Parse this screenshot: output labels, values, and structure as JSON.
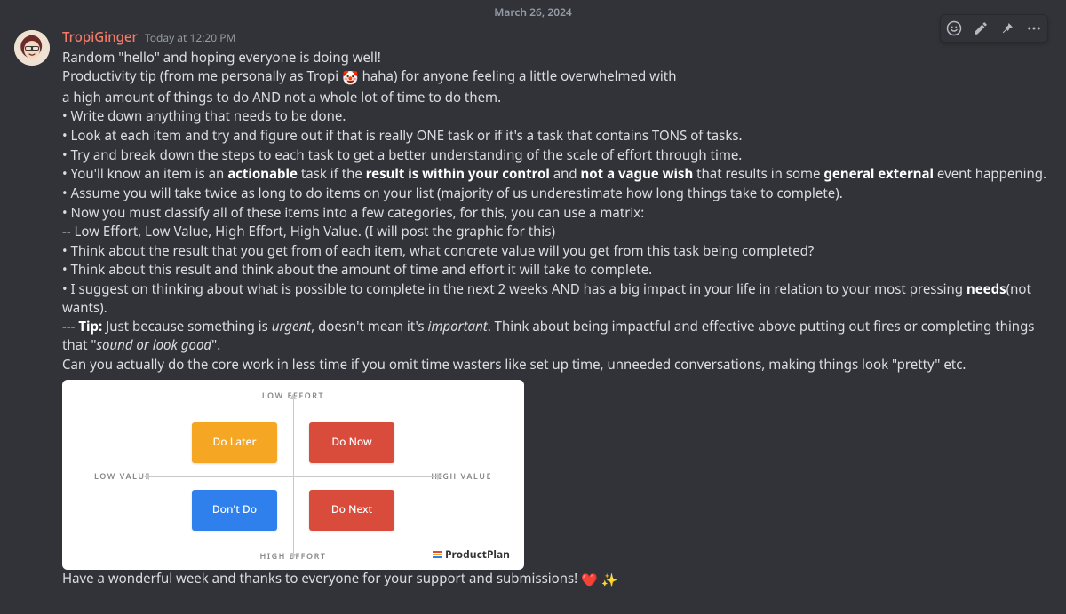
{
  "divider_date": "March 26, 2024",
  "message": {
    "username": "TropiGinger",
    "timestamp": "Today at 12:20 PM",
    "lines": {
      "l1": "Random \"hello\" and hoping everyone is doing well!",
      "l2a": "Productivity tip (from me personally as Tropi ",
      "l2b": "  haha) for anyone feeling a little overwhelmed with",
      "l3": "a high amount of things to do AND not a whole lot of time to do them.",
      "b1": " •  Write down anything that needs to be done.",
      "b2": " •  Look at each item and try and figure out if that is really ONE task or if it's a task that contains TONS of tasks.",
      "b3": " •  Try and break down the steps to each task to get a better understanding of the scale of effort through time.",
      "b4a": " •  You'll know an item is an ",
      "b4_actionable": "actionable",
      "b4b": " task if the ",
      "b4_result": "result is within your control",
      "b4c": " and ",
      "b4_notvague": "not a vague wish",
      "b4d": " that results in some ",
      "b4_general": "general external",
      "b4e": " event happening.",
      "b5": " •  Assume you will take twice as long to do items on your list (majority of us underestimate how long things take to complete).",
      "b6": " •  Now you must classify all of these items into a few categories, for this, you can use a matrix:",
      "b6sub": "-- Low Effort, Low Value, High Effort, High Value. (I will post the graphic for this)",
      "b7": " •  Think about the result that you get from of each item, what concrete value will you get from this task being completed?",
      "b8": " •  Think about this result and think about the amount of time and effort it will take to complete.",
      "b9a": " •  I suggest on thinking about what is possible to complete in the next 2 weeks AND has a big impact in your life in relation to your most pressing ",
      "b9_needs": "needs",
      "b9b": "(not wants).",
      "tip_prefix": "--- ",
      "tip_label": "Tip:",
      "tip_a": " Just because something is ",
      "tip_urgent": "urgent",
      "tip_b": ", doesn't mean it's ",
      "tip_important": "important",
      "tip_c": ". Think about being impactful and effective above putting out fires or completing things that \"",
      "tip_sound": "sound or look good",
      "tip_d": "\".",
      "tip_line2": "Can you actually do the core work in less time if you omit time wasters like set up time, unneeded conversations, making things look \"pretty\" etc.",
      "closing": "Have a wonderful week and thanks to everyone for your support and submissions! "
    },
    "emojis": {
      "clown": "🤡",
      "heart": "❤️",
      "sparkles": "✨"
    }
  },
  "matrix": {
    "axis_top": "LOW EFFORT",
    "axis_bottom": "HIGH EFFORT",
    "axis_left": "LOW VALUE",
    "axis_right": "HIGH VALUE",
    "q_tl": "Do Later",
    "q_tr": "Do Now",
    "q_bl": "Don't Do",
    "q_br": "Do Next",
    "brand": "ProductPlan"
  },
  "chart_data": {
    "type": "table",
    "title": "Value vs Effort 2x2 Prioritization Matrix",
    "x_axis": {
      "label": "Value",
      "low": "LOW VALUE",
      "high": "HIGH VALUE"
    },
    "y_axis": {
      "label": "Effort",
      "low": "LOW EFFORT",
      "high": "HIGH EFFORT"
    },
    "quadrants": [
      {
        "value": "low",
        "effort": "low",
        "action": "Do Later",
        "color": "#f5a623"
      },
      {
        "value": "high",
        "effort": "low",
        "action": "Do Now",
        "color": "#d94b3a"
      },
      {
        "value": "low",
        "effort": "high",
        "action": "Don't Do",
        "color": "#2f80ed"
      },
      {
        "value": "high",
        "effort": "high",
        "action": "Do Next",
        "color": "#d94b3a"
      }
    ],
    "source_brand": "ProductPlan"
  }
}
